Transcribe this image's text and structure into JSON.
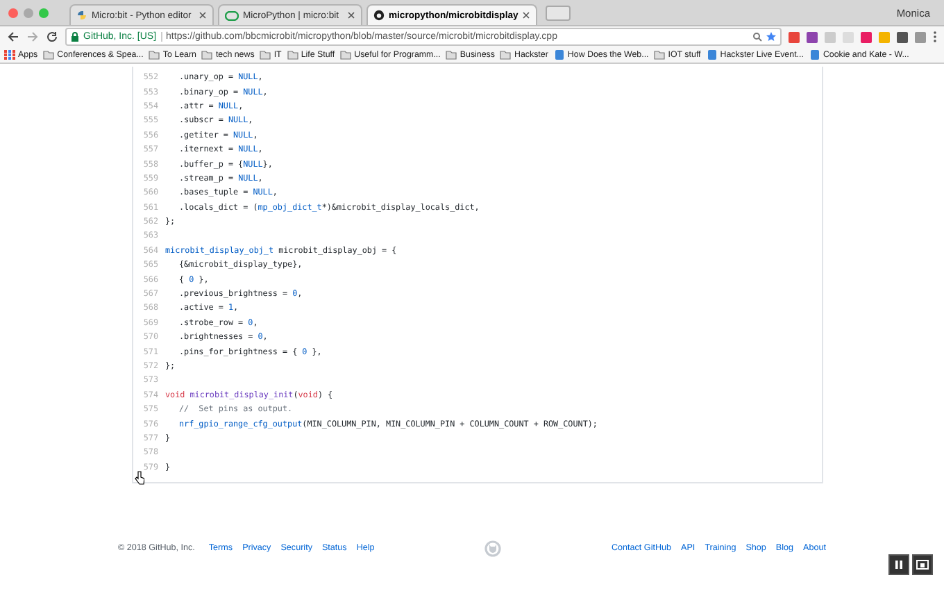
{
  "browser": {
    "tabs": [
      {
        "title": "Micro:bit - Python editor",
        "selected": false
      },
      {
        "title": "MicroPython | micro:bit",
        "selected": false
      },
      {
        "title": "micropython/microbitdisplay",
        "selected": true
      }
    ],
    "profile": "Monica",
    "address": {
      "site": "GitHub, Inc. [US]",
      "url": "https://github.com/bbcmicrobit/micropython/blob/master/source/microbit/microbitdisplay.cpp"
    },
    "bookmarks": [
      {
        "label": "Apps",
        "kind": "apps"
      },
      {
        "label": "Conferences & Spea...",
        "kind": "folder"
      },
      {
        "label": "To Learn",
        "kind": "folder"
      },
      {
        "label": "tech news",
        "kind": "folder"
      },
      {
        "label": "IT",
        "kind": "folder"
      },
      {
        "label": "Life Stuff",
        "kind": "folder"
      },
      {
        "label": "Useful for Programm...",
        "kind": "folder"
      },
      {
        "label": "Business",
        "kind": "folder"
      },
      {
        "label": "Hackster",
        "kind": "folder"
      },
      {
        "label": "How Does the Web...",
        "kind": "site"
      },
      {
        "label": "IOT stuff",
        "kind": "folder"
      },
      {
        "label": "Hackster Live Event...",
        "kind": "site"
      },
      {
        "label": "Cookie and Kate - W...",
        "kind": "site"
      }
    ]
  },
  "code": {
    "lines": [
      {
        "number": "552",
        "indented": true,
        "segments": [
          {
            "text": ".unary_op = "
          },
          {
            "text": "NULL",
            "kind": "constant"
          },
          {
            "text": ","
          }
        ]
      },
      {
        "number": "553",
        "indented": true,
        "segments": [
          {
            "text": ".binary_op = "
          },
          {
            "text": "NULL",
            "kind": "constant"
          },
          {
            "text": ","
          }
        ]
      },
      {
        "number": "554",
        "indented": true,
        "segments": [
          {
            "text": ".attr = "
          },
          {
            "text": "NULL",
            "kind": "constant"
          },
          {
            "text": ","
          }
        ]
      },
      {
        "number": "555",
        "indented": true,
        "segments": [
          {
            "text": ".subscr = "
          },
          {
            "text": "NULL",
            "kind": "constant"
          },
          {
            "text": ","
          }
        ]
      },
      {
        "number": "556",
        "indented": true,
        "segments": [
          {
            "text": ".getiter = "
          },
          {
            "text": "NULL",
            "kind": "constant"
          },
          {
            "text": ","
          }
        ]
      },
      {
        "number": "557",
        "indented": true,
        "segments": [
          {
            "text": ".iternext = "
          },
          {
            "text": "NULL",
            "kind": "constant"
          },
          {
            "text": ","
          }
        ]
      },
      {
        "number": "558",
        "indented": true,
        "segments": [
          {
            "text": ".buffer_p = {"
          },
          {
            "text": "NULL",
            "kind": "constant"
          },
          {
            "text": "},"
          }
        ]
      },
      {
        "number": "559",
        "indented": true,
        "segments": [
          {
            "text": ".stream_p = "
          },
          {
            "text": "NULL",
            "kind": "constant"
          },
          {
            "text": ","
          }
        ]
      },
      {
        "number": "560",
        "indented": true,
        "segments": [
          {
            "text": ".bases_tuple = "
          },
          {
            "text": "NULL",
            "kind": "constant"
          },
          {
            "text": ","
          }
        ]
      },
      {
        "number": "561",
        "indented": true,
        "segments": [
          {
            "text": ".locals_dict = ("
          },
          {
            "text": "mp_obj_dict_t",
            "kind": "type"
          },
          {
            "text": "*)&microbit_display_locals_dict,"
          }
        ]
      },
      {
        "number": "562",
        "indented": false,
        "segments": [
          {
            "text": "};"
          }
        ]
      },
      {
        "number": "563"
      },
      {
        "number": "564",
        "indented": false,
        "segments": [
          {
            "text": "microbit_display_obj_t",
            "kind": "type"
          },
          {
            "text": " microbit_display_obj = {"
          }
        ]
      },
      {
        "number": "565",
        "indented": true,
        "segments": [
          {
            "text": "{&microbit_display_type},"
          }
        ]
      },
      {
        "number": "566",
        "indented": true,
        "segments": [
          {
            "text": "{ "
          },
          {
            "text": "0",
            "kind": "constant"
          },
          {
            "text": " },"
          }
        ]
      },
      {
        "number": "567",
        "indented": true,
        "segments": [
          {
            "text": ".previous_brightness = "
          },
          {
            "text": "0",
            "kind": "constant"
          },
          {
            "text": ","
          }
        ]
      },
      {
        "number": "568",
        "indented": true,
        "segments": [
          {
            "text": ".active = "
          },
          {
            "text": "1",
            "kind": "constant"
          },
          {
            "text": ","
          }
        ]
      },
      {
        "number": "569",
        "indented": true,
        "segments": [
          {
            "text": ".strobe_row = "
          },
          {
            "text": "0",
            "kind": "constant"
          },
          {
            "text": ","
          }
        ]
      },
      {
        "number": "570",
        "indented": true,
        "segments": [
          {
            "text": ".brightnesses = "
          },
          {
            "text": "0",
            "kind": "constant"
          },
          {
            "text": ","
          }
        ]
      },
      {
        "number": "571",
        "indented": true,
        "segments": [
          {
            "text": ".pins_for_brightness = { "
          },
          {
            "text": "0",
            "kind": "constant"
          },
          {
            "text": " },"
          }
        ]
      },
      {
        "number": "572",
        "indented": false,
        "segments": [
          {
            "text": "};"
          }
        ]
      },
      {
        "number": "573"
      },
      {
        "number": "574",
        "indented": false,
        "segments": [
          {
            "text": "void ",
            "kind": "keyword"
          },
          {
            "text": "microbit_display_init",
            "kind": "function"
          },
          {
            "text": "("
          },
          {
            "text": "void",
            "kind": "keyword"
          },
          {
            "text": ") {"
          }
        ]
      },
      {
        "number": "575",
        "indented": true,
        "segments": [
          {
            "text": "//  Set pins as output.",
            "kind": "comment"
          }
        ]
      },
      {
        "number": "576",
        "indented": true,
        "segments": [
          {
            "text": "nrf_gpio_range_cfg_output",
            "kind": "type"
          },
          {
            "text": "(MIN_COLUMN_PIN, MIN_COLUMN_PIN + COLUMN_COUNT + ROW_COUNT);"
          }
        ]
      },
      {
        "number": "577",
        "indented": false,
        "segments": [
          {
            "text": "}"
          }
        ]
      },
      {
        "number": "578"
      },
      {
        "number": "579",
        "indented": false,
        "segments": [
          {
            "text": "}"
          }
        ]
      }
    ]
  },
  "footer": {
    "copyright": "© 2018 GitHub, Inc.",
    "left_links": [
      "Terms",
      "Privacy",
      "Security",
      "Status",
      "Help"
    ],
    "right_links": [
      "Contact GitHub",
      "API",
      "Training",
      "Shop",
      "Blog",
      "About"
    ]
  }
}
